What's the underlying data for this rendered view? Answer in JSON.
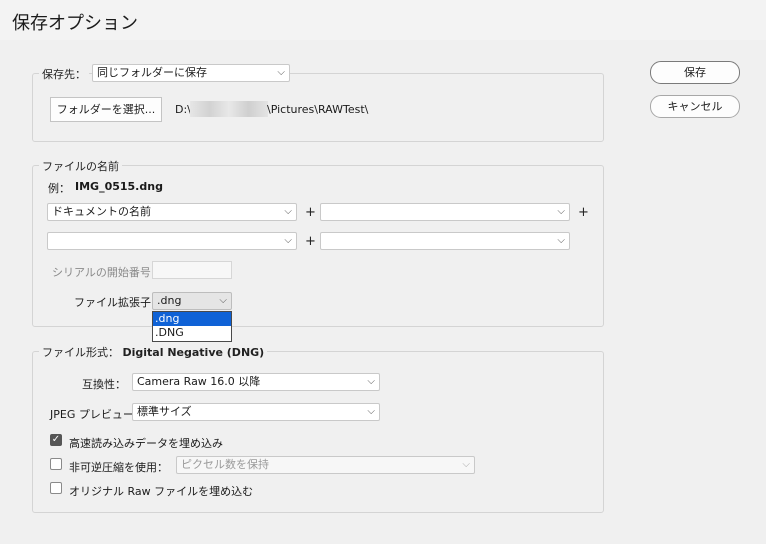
{
  "window": {
    "title": "保存オプション"
  },
  "buttons": {
    "save": "保存",
    "cancel": "キャンセル"
  },
  "destination": {
    "legend_label": "保存先：",
    "select_value": "同じフォルダーに保存",
    "choose_folder_button": "フォルダーを選択...",
    "path_prefix": "D:\\",
    "path_suffix": "\\Pictures\\RAWTest\\"
  },
  "file_naming": {
    "legend": "ファイルの名前",
    "example_label": "例：",
    "example_value": "IMG_0515.dng",
    "row1": {
      "field1": "ドキュメントの名前",
      "field2": ""
    },
    "row2": {
      "field1": "",
      "field2": ""
    },
    "plus": "+",
    "serial_label": "シリアルの開始番号：",
    "serial_value": "",
    "extension_label": "ファイル拡張子：",
    "extension_value": ".dng",
    "extension_options": [
      ".dng",
      ".DNG"
    ],
    "extension_selected_index": 0
  },
  "file_format": {
    "legend_label": "ファイル形式：",
    "legend_value": "Digital Negative (DNG)",
    "compatibility_label": "互換性：",
    "compatibility_value": "Camera Raw 16.0 以降",
    "jpeg_preview_label": "JPEG プレビュー：",
    "jpeg_preview_value": "標準サイズ",
    "embed_fast_load": {
      "label": "高速読み込みデータを埋め込み",
      "checked": true
    },
    "lossy_compression": {
      "label": "非可逆圧縮を使用：",
      "checked": false,
      "select_value": "ピクセル数を保持"
    },
    "embed_raw": {
      "label": "オリジナル Raw ファイルを埋め込む",
      "checked": false
    }
  }
}
